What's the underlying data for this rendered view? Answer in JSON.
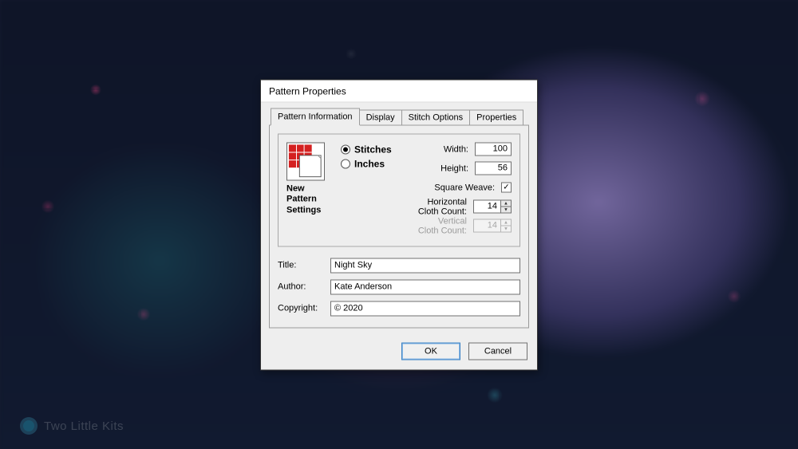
{
  "watermark": "Two Little Kits",
  "dialog": {
    "title": "Pattern Properties",
    "tabs": [
      {
        "label": "Pattern Information",
        "active": true
      },
      {
        "label": "Display",
        "active": false
      },
      {
        "label": "Stitch Options",
        "active": false
      },
      {
        "label": "Properties",
        "active": false
      }
    ],
    "settings": {
      "icon_label": "New\nPattern\nSettings",
      "unit_options": {
        "stitches": "Stitches",
        "inches": "Inches"
      },
      "unit_selected": "stitches",
      "width_label": "Width:",
      "width_value": "100",
      "height_label": "Height:",
      "height_value": "56",
      "square_weave_label": "Square Weave:",
      "square_weave_checked": true,
      "hcount_label": "Horizontal Cloth Count:",
      "hcount_value": "14",
      "vcount_label": "Vertical Cloth Count:",
      "vcount_value": "14",
      "vcount_enabled": false
    },
    "fields": {
      "title_label": "Title:",
      "title_value": "Night Sky",
      "author_label": "Author:",
      "author_value": "Kate Anderson",
      "copyright_label": "Copyright:",
      "copyright_value": "© 2020"
    },
    "buttons": {
      "ok": "OK",
      "cancel": "Cancel"
    }
  }
}
